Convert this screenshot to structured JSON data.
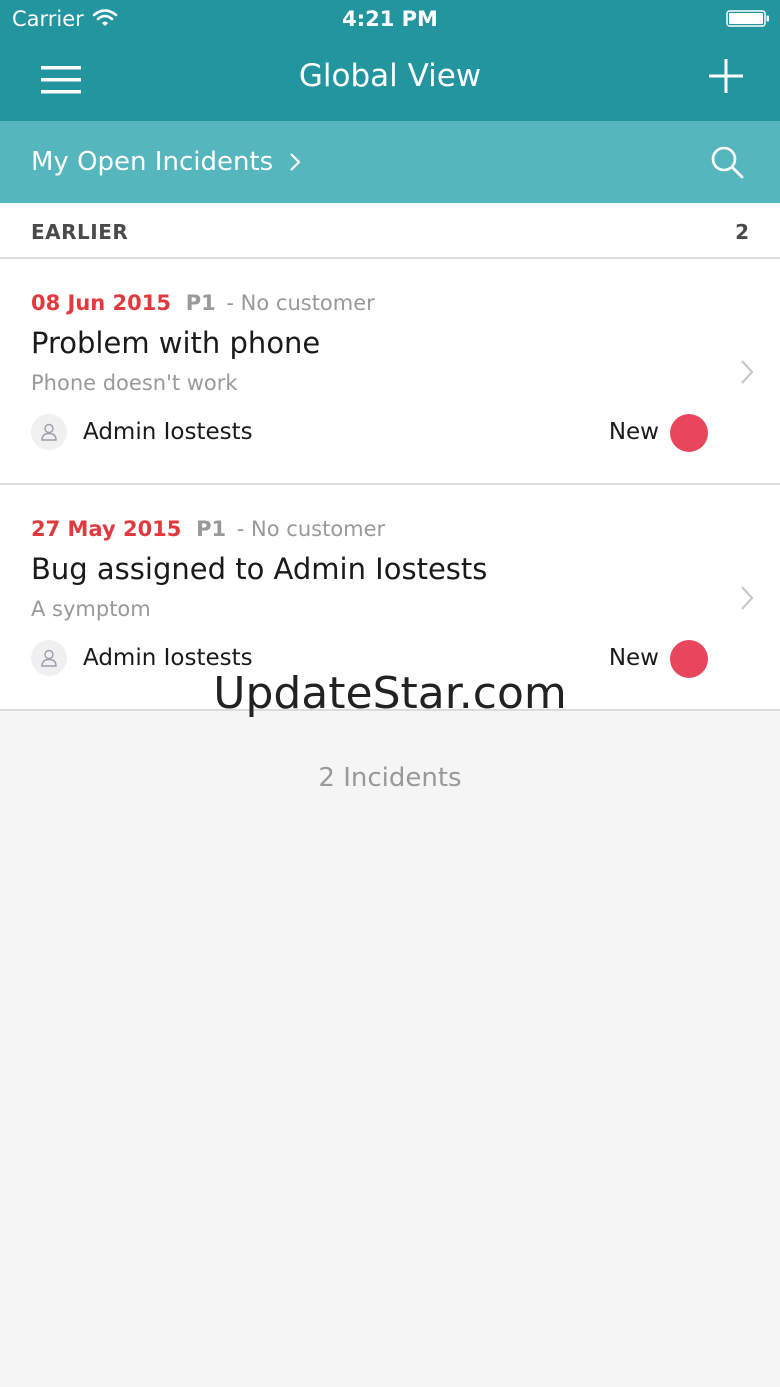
{
  "status_bar": {
    "carrier": "Carrier",
    "time": "4:21 PM"
  },
  "nav": {
    "title": "Global View"
  },
  "filter": {
    "label": "My Open Incidents"
  },
  "section": {
    "title": "EARLIER",
    "count": "2"
  },
  "incidents": [
    {
      "date": "08 Jun 2015",
      "priority": "P1",
      "customer": "- No customer",
      "title": "Problem with phone",
      "subtitle": "Phone doesn't work",
      "assignee": "Admin Iostests",
      "state": "New"
    },
    {
      "date": "27 May 2015",
      "priority": "P1",
      "customer": "- No customer",
      "title": "Bug assigned to Admin Iostests",
      "subtitle": "A symptom",
      "assignee": "Admin Iostests",
      "state": "New"
    }
  ],
  "footer": {
    "count_label": "2 Incidents"
  },
  "watermark": "UpdateStar.com",
  "colors": {
    "header": "#22959f",
    "filter_bar": "#55b6bd",
    "date": "#e03a3e",
    "state_new": "#e8465c"
  }
}
